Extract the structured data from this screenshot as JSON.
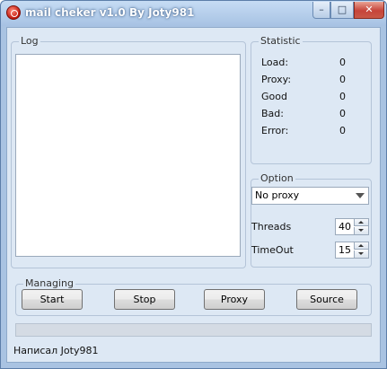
{
  "window": {
    "title": "mail cheker v1.0 By Joty981"
  },
  "controls": {
    "minimize": "–",
    "maximize": "□",
    "close": "✕"
  },
  "log": {
    "label": "Log",
    "content": ""
  },
  "statistic": {
    "label": "Statistic",
    "rows": [
      {
        "label": "Load:",
        "value": "0"
      },
      {
        "label": "Proxy:",
        "value": "0"
      },
      {
        "label": "Good",
        "value": "0"
      },
      {
        "label": "Bad:",
        "value": "0"
      },
      {
        "label": "Error:",
        "value": "0"
      }
    ]
  },
  "option": {
    "label": "Option",
    "proxy_select": "No proxy",
    "threads_label": "Threads",
    "threads_value": "40",
    "timeout_label": "TimeOut",
    "timeout_value": "15"
  },
  "managing": {
    "label": "Managing",
    "start": "Start",
    "stop": "Stop",
    "proxy": "Proxy",
    "source": "Source"
  },
  "progress": {
    "value": 0
  },
  "footer": {
    "text": "Написал Joty981"
  },
  "colors": {
    "accent": "#c0160b",
    "window_frame": "#a9c3e2",
    "client": "#dde8f4"
  }
}
